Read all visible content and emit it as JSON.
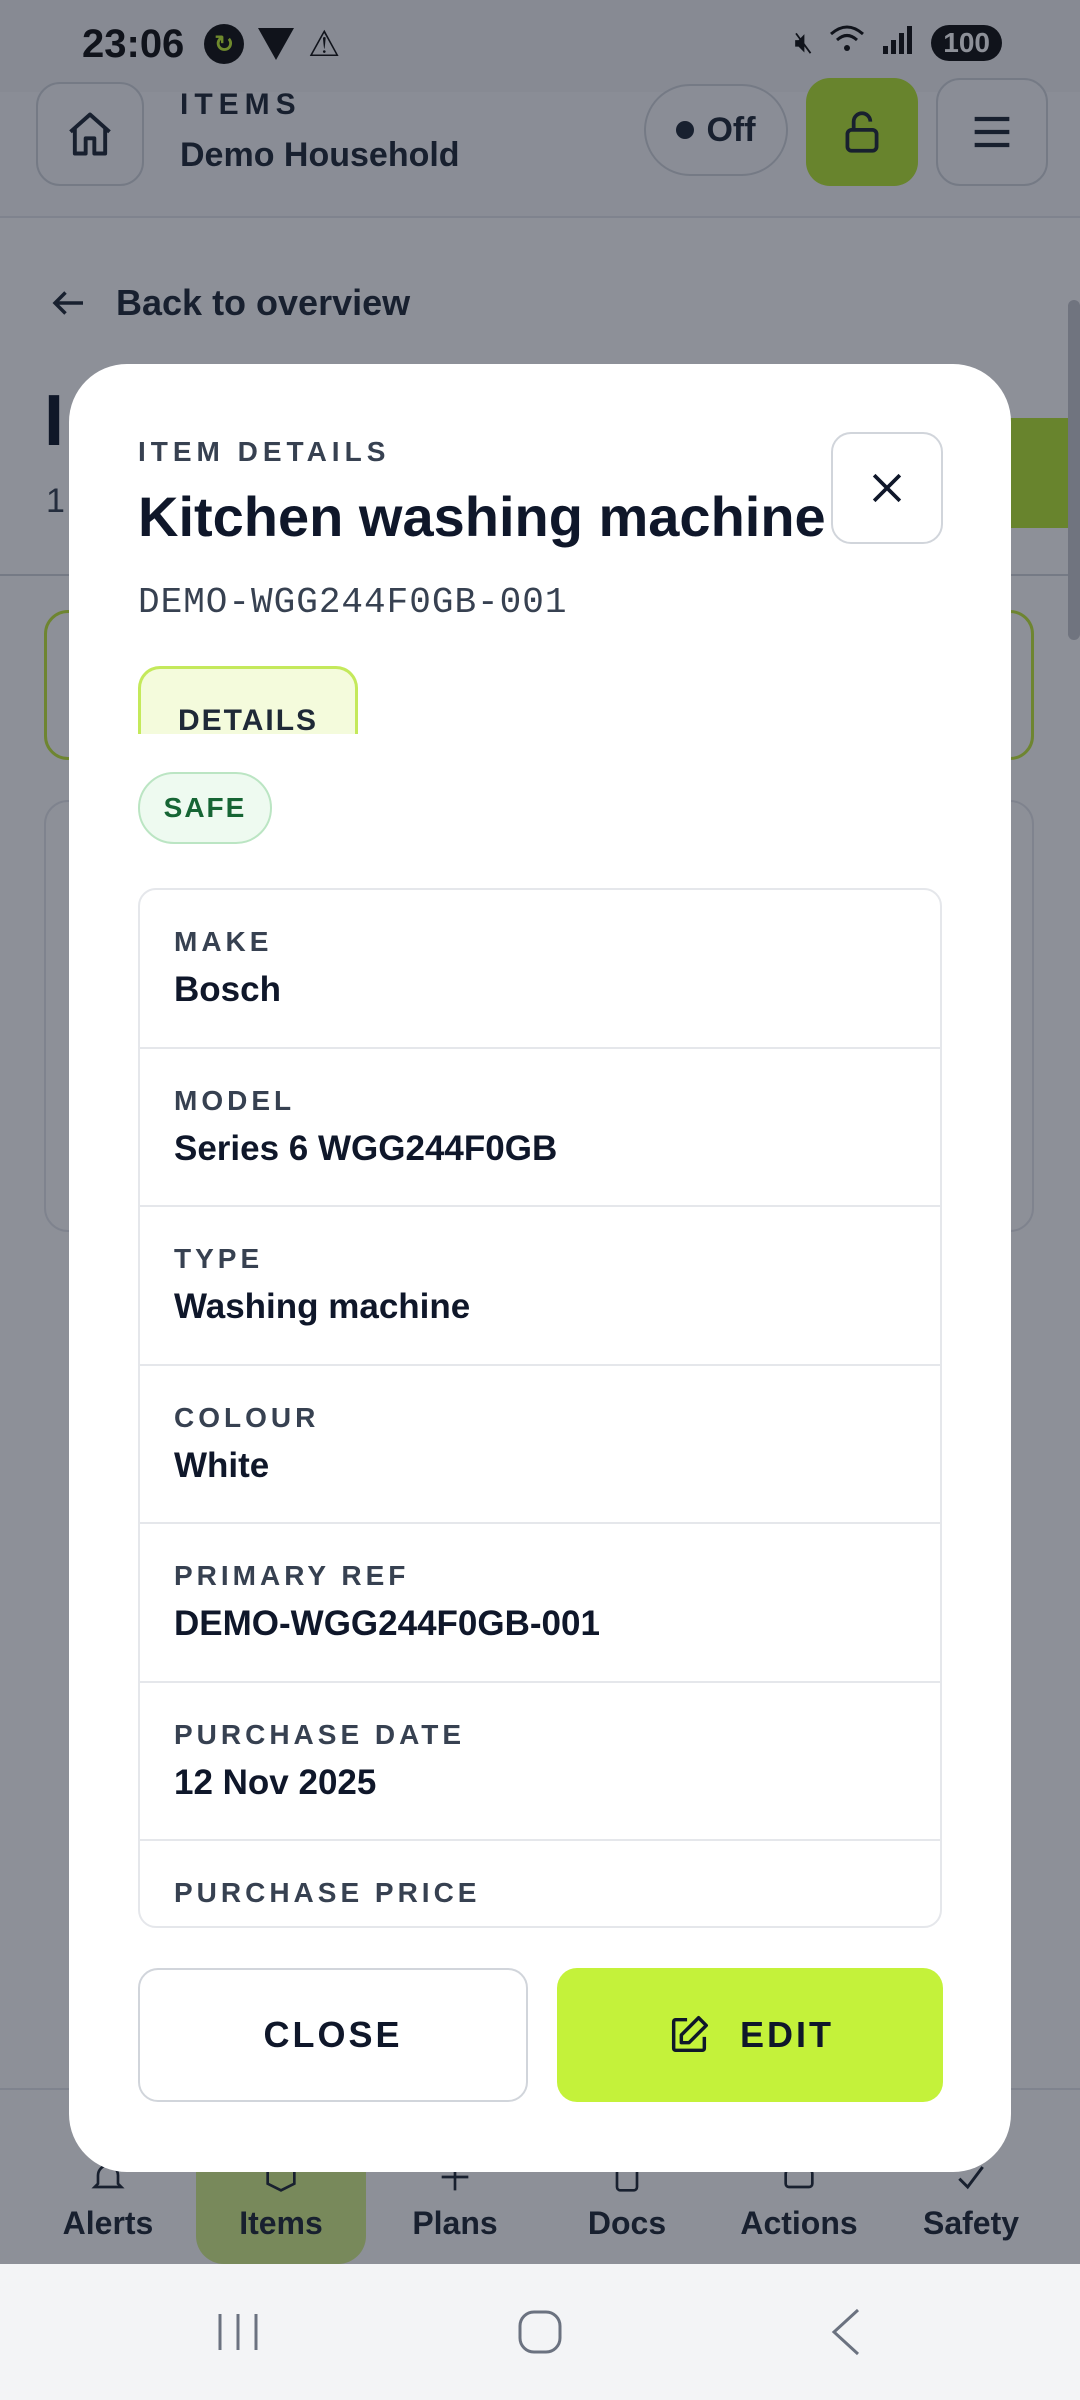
{
  "status_bar": {
    "time": "23:06",
    "battery": "100",
    "icons": [
      "sync-app-icon",
      "vpn-icon",
      "warning-icon",
      "mute-icon",
      "wifi-icon",
      "signal-icon"
    ]
  },
  "header": {
    "section": "ITEMS",
    "household": "Demo Household",
    "toggle_label": "Off"
  },
  "page": {
    "back_label": "Back to overview",
    "title_partial": "I",
    "subtitle_partial": "1"
  },
  "bottom_nav": {
    "items": [
      {
        "label": "Alerts",
        "icon": "bell-icon",
        "active": false
      },
      {
        "label": "Items",
        "icon": "box-icon",
        "active": true
      },
      {
        "label": "Plans",
        "icon": "plan-icon",
        "active": false
      },
      {
        "label": "Docs",
        "icon": "doc-icon",
        "active": false
      },
      {
        "label": "Actions",
        "icon": "actions-icon",
        "active": false
      },
      {
        "label": "Safety",
        "icon": "check-icon",
        "active": false
      }
    ]
  },
  "modal": {
    "eyebrow": "ITEM DETAILS",
    "title": "Kitchen washing machine",
    "reference": "DEMO-WGG244F0GB-001",
    "tab_label": "DETAILS",
    "status_badge": "SAFE",
    "fields": [
      {
        "label": "MAKE",
        "value": "Bosch"
      },
      {
        "label": "MODEL",
        "value": "Series 6 WGG244F0GB"
      },
      {
        "label": "TYPE",
        "value": "Washing machine"
      },
      {
        "label": "COLOUR",
        "value": "White"
      },
      {
        "label": "PRIMARY REF",
        "value": "DEMO-WGG244F0GB-001"
      },
      {
        "label": "PURCHASE DATE",
        "value": "12 Nov 2025"
      },
      {
        "label": "PURCHASE PRICE",
        "value": ""
      }
    ],
    "close_label": "CLOSE",
    "edit_label": "EDIT"
  },
  "colors": {
    "accent": "#c4f23a",
    "safe_badge_text": "#166534",
    "scrim": "rgba(17,24,39,0.48)"
  }
}
